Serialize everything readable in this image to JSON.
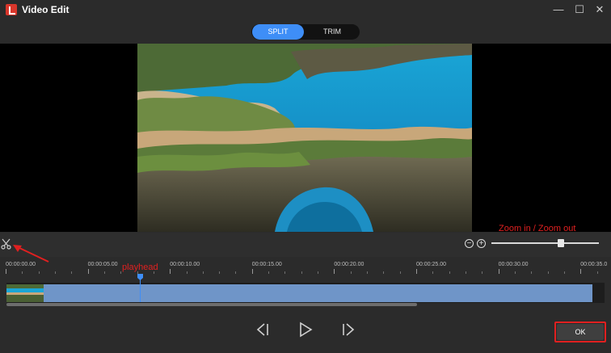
{
  "window": {
    "title": "Video Edit",
    "controls": {
      "minimize": "—",
      "maximize": "☐",
      "close": "✕"
    }
  },
  "mode_tabs": [
    {
      "label": "SPLIT",
      "active": true
    },
    {
      "label": "TRIM",
      "active": false
    }
  ],
  "timeline": {
    "ticks": [
      "00:00:00.00",
      "00:00:05.00",
      "00:00:10.00",
      "00:00:15.00",
      "00:00:20.00",
      "00:00:25.00",
      "00:00:30.00",
      "00:00:35.0"
    ],
    "zoom_level": 0.66,
    "playhead_time": "00:00:08.0"
  },
  "transport": {
    "prev_label": "previous-frame",
    "play_label": "play",
    "next_label": "next-frame"
  },
  "footer": {
    "ok_label": "OK"
  },
  "annotations": {
    "zoom": "Zoom in / Zoom out",
    "playhead": "playhead"
  },
  "colors": {
    "accent": "#3e8ef7",
    "clip": "#6f95c8",
    "annotation": "#e02020"
  }
}
